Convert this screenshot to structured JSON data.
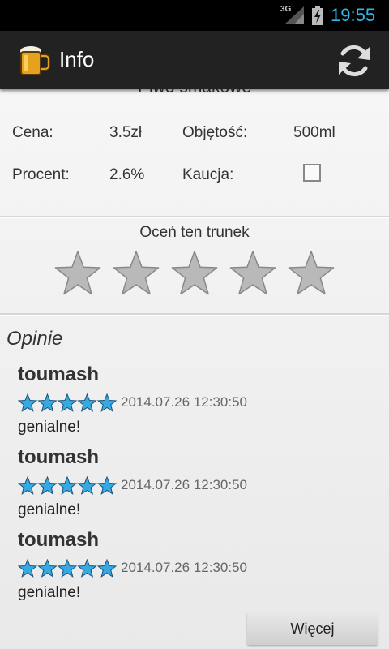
{
  "status_bar": {
    "network": "3G",
    "time": "19:55"
  },
  "action_bar": {
    "title": "Info",
    "app_icon": "beer-mug-icon",
    "refresh_icon": "refresh-icon"
  },
  "beer": {
    "name": "Piwo smakowe",
    "price_label": "Cena:",
    "price_value": "3.5zł",
    "volume_label": "Objętość:",
    "volume_value": "500ml",
    "percent_label": "Procent:",
    "percent_value": "2.6%",
    "deposit_label": "Kaucja:",
    "deposit_checked": false
  },
  "rating": {
    "label": "Oceń ten trunek",
    "current": 0,
    "max": 5
  },
  "reviews_heading": "Opinie",
  "reviews": [
    {
      "user": "toumash",
      "stars": 5,
      "date": "2014.07.26 12:30:50",
      "text": "genialne!"
    },
    {
      "user": "toumash",
      "stars": 5,
      "date": "2014.07.26 12:30:50",
      "text": "genialne!"
    },
    {
      "user": "toumash",
      "stars": 5,
      "date": "2014.07.26 12:30:50",
      "text": "genialne!"
    }
  ],
  "more_button": "Więcej",
  "colors": {
    "accent": "#33b5e5",
    "action_bar": "#222222",
    "star_empty": "#b9b9b9",
    "star_filled": "#35a9e0"
  }
}
